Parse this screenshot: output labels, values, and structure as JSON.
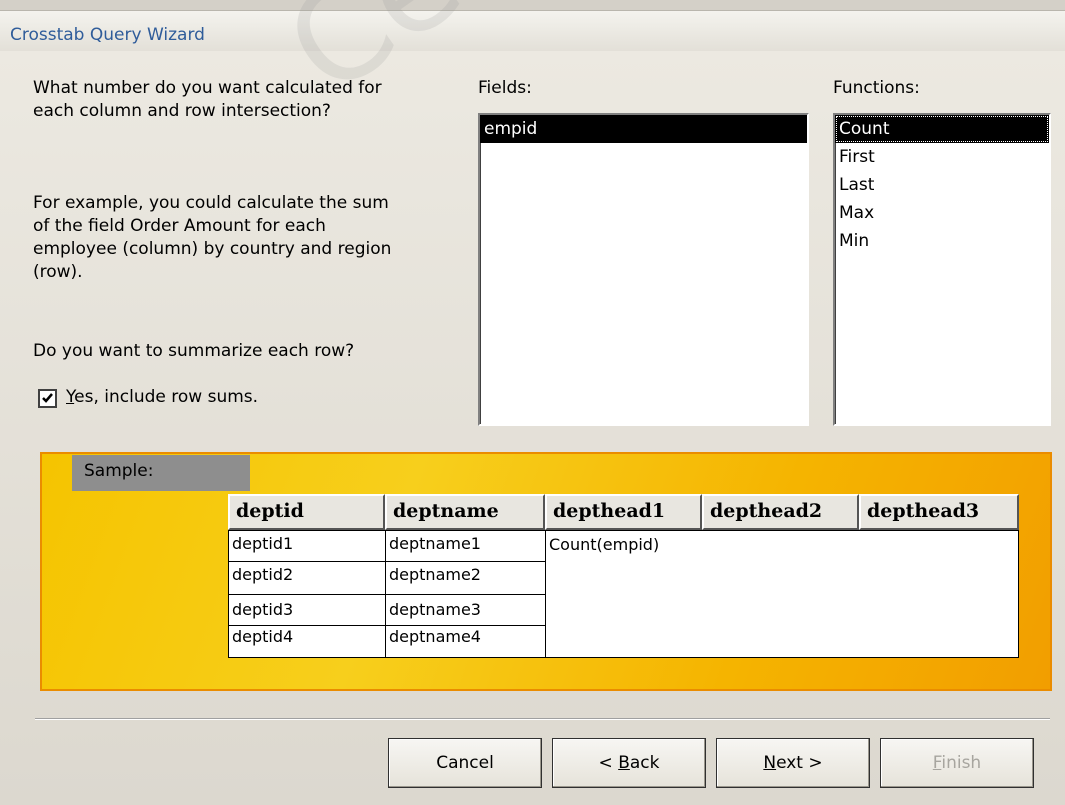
{
  "window": {
    "title": "Crosstab Query Wizard"
  },
  "prompt": {
    "line1": "What number do you want calculated for",
    "line2": "each column and row intersection?",
    "example1": "For example, you could calculate the sum",
    "example2": "of the field Order Amount for each",
    "example3": "employee (column)  by country and region",
    "example4": "(row).",
    "summarize_q": "Do you want to summarize each row?",
    "checkbox_label_u": "Y",
    "checkbox_label_rest": "es, include row sums.",
    "checkbox_checked": true
  },
  "fields": {
    "label": "Fields:",
    "items": [
      "empid"
    ],
    "selected": "empid"
  },
  "functions": {
    "label": "Functions:",
    "items": [
      "Count",
      "First",
      "Last",
      "Max",
      "Min"
    ],
    "selected": "Count"
  },
  "sample": {
    "label": "Sample:",
    "headers": [
      "deptid",
      "deptname",
      "depthead1",
      "depthead2",
      "depthead3"
    ],
    "rows": [
      [
        "deptid1",
        "deptname1"
      ],
      [
        "deptid2",
        "deptname2"
      ],
      [
        "deptid3",
        "deptname3"
      ],
      [
        "deptid4",
        "deptname4"
      ]
    ],
    "value_cell": "Count(empid)"
  },
  "buttons": {
    "cancel": "Cancel",
    "back_pre": "< ",
    "back_u": "B",
    "back_rest": "ack",
    "next_u": "N",
    "next_rest": "ext >",
    "finish_u": "F",
    "finish_rest": "inish"
  },
  "watermark": "CertKiller"
}
